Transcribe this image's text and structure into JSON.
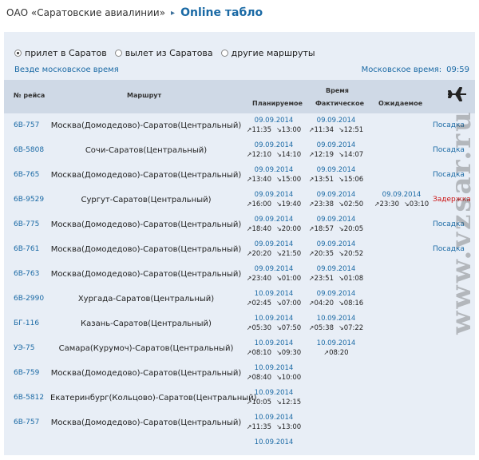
{
  "breadcrumb": {
    "company": "ОАО «Саратовские авиалинии»",
    "separator": "▸",
    "title": "Online табло"
  },
  "radios": [
    {
      "label": "прилет в Саратов",
      "checked": true
    },
    {
      "label": "вылет из Саратова",
      "checked": false
    },
    {
      "label": "другие маршруты",
      "checked": false
    }
  ],
  "timezone_link": "Везде московское время",
  "moscow_time": {
    "label": "Московское время:",
    "value": "09:59"
  },
  "table": {
    "headers": {
      "flight": "№ рейса",
      "route": "Маршрут",
      "time": "Время",
      "planned": "Планируемое",
      "actual": "Фактическое",
      "expected": "Ожидаемое"
    },
    "rows": [
      {
        "flight": "6В-757",
        "route": "Москва(Домодедово)-Саратов(Центральный)",
        "plan_date": "09.09.2014",
        "plan_dep": "11:35",
        "plan_arr": "13:00",
        "fact_date": "09.09.2014",
        "fact_dep": "11:34",
        "fact_arr": "12:51",
        "exp_date": "",
        "exp_dep": "",
        "exp_arr": "",
        "status": "Посадка"
      },
      {
        "flight": "6В-5808",
        "route": "Сочи-Саратов(Центральный)",
        "plan_date": "09.09.2014",
        "plan_dep": "12:10",
        "plan_arr": "14:10",
        "fact_date": "09.09.2014",
        "fact_dep": "12:19",
        "fact_arr": "14:07",
        "exp_date": "",
        "exp_dep": "",
        "exp_arr": "",
        "status": "Посадка"
      },
      {
        "flight": "6В-765",
        "route": "Москва(Домодедово)-Саратов(Центральный)",
        "plan_date": "09.09.2014",
        "plan_dep": "13:40",
        "plan_arr": "15:00",
        "fact_date": "09.09.2014",
        "fact_dep": "13:51",
        "fact_arr": "15:06",
        "exp_date": "",
        "exp_dep": "",
        "exp_arr": "",
        "status": "Посадка"
      },
      {
        "flight": "6В-9529",
        "route": "Сургут-Саратов(Центральный)",
        "plan_date": "09.09.2014",
        "plan_dep": "16:00",
        "plan_arr": "19:40",
        "fact_date": "09.09.2014",
        "fact_dep": "23:38",
        "fact_arr": "02:50",
        "exp_date": "09.09.2014",
        "exp_dep": "23:30",
        "exp_arr": "03:10",
        "status": "Задержка"
      },
      {
        "flight": "6В-775",
        "route": "Москва(Домодедово)-Саратов(Центральный)",
        "plan_date": "09.09.2014",
        "plan_dep": "18:40",
        "plan_arr": "20:00",
        "fact_date": "09.09.2014",
        "fact_dep": "18:57",
        "fact_arr": "20:05",
        "exp_date": "",
        "exp_dep": "",
        "exp_arr": "",
        "status": "Посадка"
      },
      {
        "flight": "6В-761",
        "route": "Москва(Домодедово)-Саратов(Центральный)",
        "plan_date": "09.09.2014",
        "plan_dep": "20:20",
        "plan_arr": "21:50",
        "fact_date": "09.09.2014",
        "fact_dep": "20:35",
        "fact_arr": "20:52",
        "exp_date": "",
        "exp_dep": "",
        "exp_arr": "",
        "status": "Посадка"
      },
      {
        "flight": "6В-763",
        "route": "Москва(Домодедово)-Саратов(Центральный)",
        "plan_date": "09.09.2014",
        "plan_dep": "23:40",
        "plan_arr": "01:00",
        "fact_date": "09.09.2014",
        "fact_dep": "23:51",
        "fact_arr": "01:08",
        "exp_date": "",
        "exp_dep": "",
        "exp_arr": "",
        "status": ""
      },
      {
        "flight": "6В-2990",
        "route": "Хургада-Саратов(Центральный)",
        "plan_date": "10.09.2014",
        "plan_dep": "02:45",
        "plan_arr": "07:00",
        "fact_date": "09.09.2014",
        "fact_dep": "04:20",
        "fact_arr": "08:16",
        "exp_date": "",
        "exp_dep": "",
        "exp_arr": "",
        "status": ""
      },
      {
        "flight": "БГ-116",
        "route": "Казань-Саратов(Центральный)",
        "plan_date": "10.09.2014",
        "plan_dep": "05:30",
        "plan_arr": "07:50",
        "fact_date": "10.09.2014",
        "fact_dep": "05:38",
        "fact_arr": "07:22",
        "exp_date": "",
        "exp_dep": "",
        "exp_arr": "",
        "status": ""
      },
      {
        "flight": "УЭ-75",
        "route": "Самара(Курумоч)-Саратов(Центральный)",
        "plan_date": "10.09.2014",
        "plan_dep": "08:10",
        "plan_arr": "09:30",
        "fact_date": "10.09.2014",
        "fact_dep": "08:20",
        "fact_arr": "",
        "exp_date": "",
        "exp_dep": "",
        "exp_arr": "",
        "status": ""
      },
      {
        "flight": "6В-759",
        "route": "Москва(Домодедово)-Саратов(Центральный)",
        "plan_date": "10.09.2014",
        "plan_dep": "08:40",
        "plan_arr": "10:00",
        "fact_date": "",
        "fact_dep": "",
        "fact_arr": "",
        "exp_date": "",
        "exp_dep": "",
        "exp_arr": "",
        "status": ""
      },
      {
        "flight": "6В-5812",
        "route": "Екатеринбург(Кольцово)-Саратов(Центральный)",
        "plan_date": "10.09.2014",
        "plan_dep": "10:05",
        "plan_arr": "12:15",
        "fact_date": "",
        "fact_dep": "",
        "fact_arr": "",
        "exp_date": "",
        "exp_dep": "",
        "exp_arr": "",
        "status": ""
      },
      {
        "flight": "6В-757",
        "route": "Москва(Домодедово)-Саратов(Центральный)",
        "plan_date": "10.09.2014",
        "plan_dep": "11:35",
        "plan_arr": "13:00",
        "fact_date": "",
        "fact_dep": "",
        "fact_arr": "",
        "exp_date": "",
        "exp_dep": "",
        "exp_arr": "",
        "status": ""
      },
      {
        "flight": "",
        "route": "",
        "plan_date": "10.09.2014",
        "plan_dep": "",
        "plan_arr": "",
        "fact_date": "",
        "fact_dep": "",
        "fact_arr": "",
        "exp_date": "",
        "exp_dep": "",
        "exp_arr": "",
        "status": ""
      }
    ]
  },
  "icons": {
    "plane": "airplane-icon",
    "departure_arrow": "↗",
    "arrival_arrow": "↘"
  },
  "watermark": "www.vzsar.ru",
  "colors": {
    "link": "#1b6aa5",
    "delay": "#cc1111",
    "panel_bg": "#e8eef6",
    "header_bg": "#cfd9e6"
  }
}
